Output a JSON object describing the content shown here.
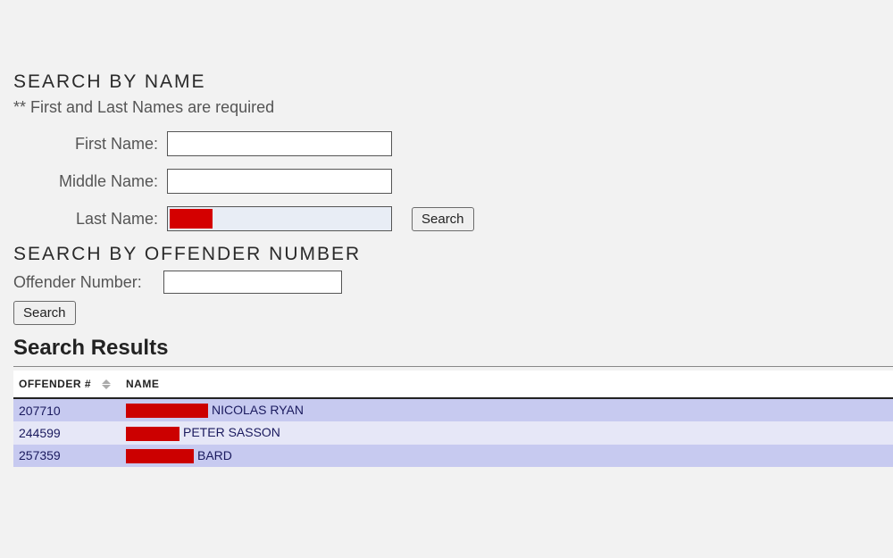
{
  "searchByName": {
    "title": "SEARCH BY NAME",
    "note": "** First and Last Names are required",
    "firstNameLabel": "First Name:",
    "firstNameValue": "",
    "middleNameLabel": "Middle Name:",
    "middleNameValue": "",
    "lastNameLabel": "Last Name:",
    "lastNameValue": "",
    "searchButton": "Search"
  },
  "searchByNumber": {
    "title": "SEARCH BY OFFENDER NUMBER",
    "offenderNumberLabel": "Offender Number:",
    "offenderNumberValue": "",
    "searchButton": "Search"
  },
  "results": {
    "title": "Search Results",
    "columns": {
      "offender": "OFFENDER #",
      "name": "NAME"
    },
    "rows": [
      {
        "offender": "207710",
        "redactWidth": 92,
        "nameRest": "NICOLAS RYAN"
      },
      {
        "offender": "244599",
        "redactWidth": 60,
        "nameRest": "PETER SASSON"
      },
      {
        "offender": "257359",
        "redactWidth": 76,
        "nameRest": "BARD"
      }
    ]
  }
}
